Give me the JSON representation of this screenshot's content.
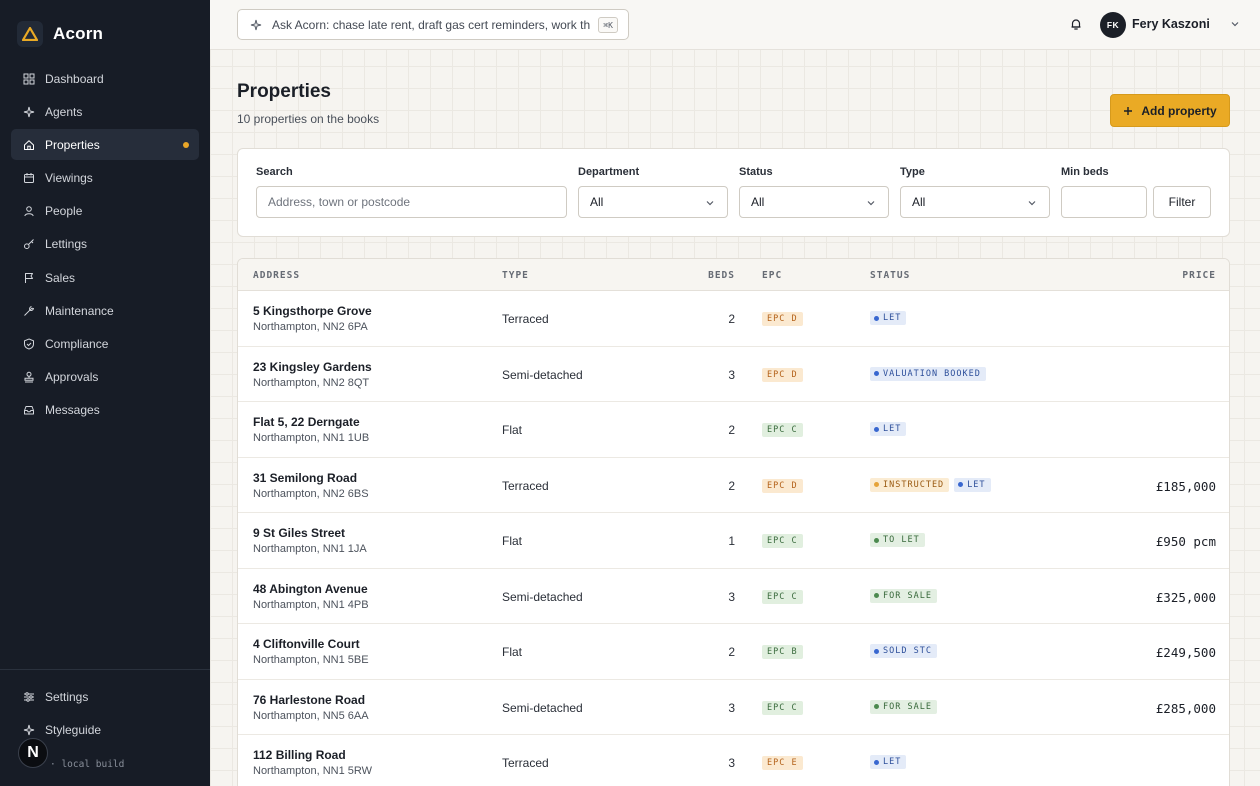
{
  "app": {
    "name": "Acorn"
  },
  "sidebar": {
    "items": [
      {
        "label": "Dashboard",
        "icon": "dashboard-icon"
      },
      {
        "label": "Agents",
        "icon": "sparkle-icon"
      },
      {
        "label": "Properties",
        "icon": "home-icon",
        "active": true
      },
      {
        "label": "Viewings",
        "icon": "calendar-icon"
      },
      {
        "label": "People",
        "icon": "person-icon"
      },
      {
        "label": "Lettings",
        "icon": "key-icon"
      },
      {
        "label": "Sales",
        "icon": "flag-icon"
      },
      {
        "label": "Maintenance",
        "icon": "wrench-icon"
      },
      {
        "label": "Compliance",
        "icon": "shield-icon"
      },
      {
        "label": "Approvals",
        "icon": "stamp-icon"
      },
      {
        "label": "Messages",
        "icon": "inbox-icon"
      }
    ],
    "bottom": [
      {
        "label": "Settings",
        "icon": "sliders-icon"
      },
      {
        "label": "Styleguide",
        "icon": "sparkle-icon"
      }
    ],
    "badge_letter": "N",
    "build": "· local build"
  },
  "topbar": {
    "ask_text": "Ask Acorn: chase late rent, draft gas cert reminders, work th",
    "shortcut": "⌘K",
    "user_initials": "FK",
    "user_name": "Fery Kaszoni"
  },
  "page": {
    "title": "Properties",
    "subtitle": "10 properties on the books",
    "add_label": "Add property"
  },
  "filters": {
    "search_label": "Search",
    "search_placeholder": "Address, town or postcode",
    "department_label": "Department",
    "department_value": "All",
    "status_label": "Status",
    "status_value": "All",
    "type_label": "Type",
    "type_value": "All",
    "min_beds_label": "Min beds",
    "filter_label": "Filter"
  },
  "table": {
    "columns": [
      "ADDRESS",
      "TYPE",
      "BEDS",
      "EPC",
      "STATUS",
      "PRICE"
    ],
    "rows": [
      {
        "line1": "5 Kingsthorpe Grove",
        "line2": "Northampton, NN2 6PA",
        "type": "Terraced",
        "beds": "2",
        "epc": "EPC D",
        "statuses": [
          "LET"
        ],
        "price": ""
      },
      {
        "line1": "23 Kingsley Gardens",
        "line2": "Northampton, NN2 8QT",
        "type": "Semi-detached",
        "beds": "3",
        "epc": "EPC D",
        "statuses": [
          "VALUATION BOOKED"
        ],
        "price": ""
      },
      {
        "line1": "Flat 5, 22 Derngate",
        "line2": "Northampton, NN1 1UB",
        "type": "Flat",
        "beds": "2",
        "epc": "EPC C",
        "statuses": [
          "LET"
        ],
        "price": ""
      },
      {
        "line1": "31 Semilong Road",
        "line2": "Northampton, NN2 6BS",
        "type": "Terraced",
        "beds": "2",
        "epc": "EPC D",
        "statuses": [
          "INSTRUCTED",
          "LET"
        ],
        "price": "£185,000"
      },
      {
        "line1": "9 St Giles Street",
        "line2": "Northampton, NN1 1JA",
        "type": "Flat",
        "beds": "1",
        "epc": "EPC C",
        "statuses": [
          "TO LET"
        ],
        "price": "£950 pcm"
      },
      {
        "line1": "48 Abington Avenue",
        "line2": "Northampton, NN1 4PB",
        "type": "Semi-detached",
        "beds": "3",
        "epc": "EPC C",
        "statuses": [
          "FOR SALE"
        ],
        "price": "£325,000"
      },
      {
        "line1": "4 Cliftonville Court",
        "line2": "Northampton, NN1 5BE",
        "type": "Flat",
        "beds": "2",
        "epc": "EPC B",
        "statuses": [
          "SOLD STC"
        ],
        "price": "£249,500"
      },
      {
        "line1": "76 Harlestone Road",
        "line2": "Northampton, NN5 6AA",
        "type": "Semi-detached",
        "beds": "3",
        "epc": "EPC C",
        "statuses": [
          "FOR SALE"
        ],
        "price": "£285,000"
      },
      {
        "line1": "112 Billing Road",
        "line2": "Northampton, NN1 5RW",
        "type": "Terraced",
        "beds": "3",
        "epc": "EPC E",
        "statuses": [
          "LET"
        ],
        "price": ""
      }
    ]
  },
  "colors": {
    "accent": "#eaaa25",
    "sidebar_bg": "#171c26",
    "epc_amber_bg": "#fbe9d0",
    "epc_amber_fg": "#b4621a",
    "epc_green_bg": "#e1efdf",
    "epc_green_fg": "#3a6b3d",
    "status_blue_bg": "#e4ebf8",
    "status_blue_fg": "#2d4f9a",
    "status_blue_dot": "#3867d0",
    "status_green_bg": "#e3efe2",
    "status_green_fg": "#37683a",
    "status_green_dot": "#4c8a4f",
    "status_amber_bg": "#fbecd3",
    "status_amber_fg": "#9a5a12",
    "status_amber_dot": "#e5a33a"
  }
}
